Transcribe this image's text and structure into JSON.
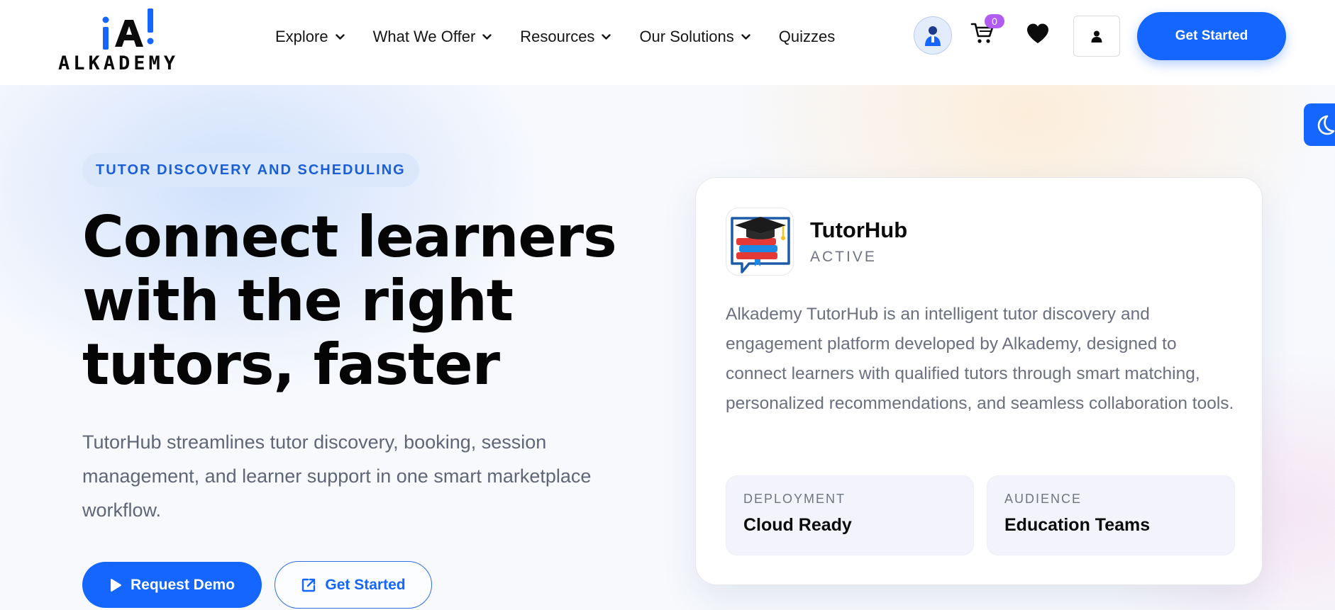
{
  "header": {
    "logo_text": "ALKADEMY",
    "logo_mark": "¡A!",
    "nav": [
      {
        "label": "Explore"
      },
      {
        "label": "What We Offer"
      },
      {
        "label": "Resources"
      },
      {
        "label": "Our Solutions"
      },
      {
        "label": "Quizzes"
      }
    ],
    "cart_count": "0",
    "cta_label": "Get Started",
    "icons": [
      "user-avatar-icon",
      "cart-icon",
      "heart-icon",
      "account-icon",
      "moon-icon"
    ]
  },
  "hero": {
    "eyebrow": "TUTOR DISCOVERY AND SCHEDULING",
    "title_lines": [
      "Connect learners",
      "with the right",
      "tutors, faster"
    ],
    "subtitle": "TutorHub streamlines tutor discovery, booking, session management, and learner support in one smart marketplace workflow.",
    "primary_button": "Request Demo",
    "secondary_button": "Get Started"
  },
  "card": {
    "name": "TutorHub",
    "status": "ACTIVE",
    "description": "Alkademy TutorHub is an intelligent tutor discovery and engagement platform developed by Alkademy, designed to connect learners with qualified tutors through smart matching, personalized recommendations, and seamless collaboration tools.",
    "stats": [
      {
        "label": "DEPLOYMENT",
        "value": "Cloud Ready"
      },
      {
        "label": "AUDIENCE",
        "value": "Education Teams"
      }
    ]
  },
  "colors": {
    "brand_blue": "#1466ff",
    "badge_purple": "#b05cf0",
    "pill_bg": "#dbe7fb"
  }
}
